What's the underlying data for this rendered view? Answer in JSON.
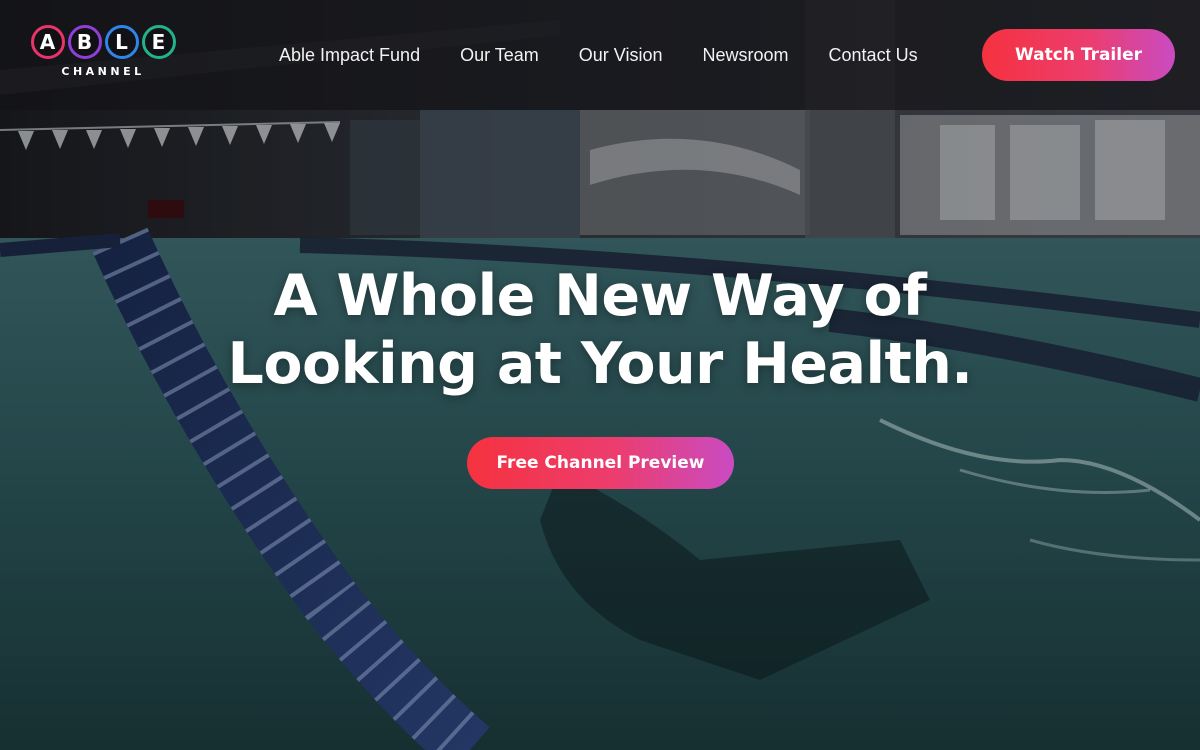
{
  "brand": {
    "logo_letters": [
      "A",
      "B",
      "L",
      "E"
    ],
    "logo_subtitle": "CHANNEL",
    "colors": {
      "ring_a": "#e8336b",
      "ring_b": "#8f3fd6",
      "ring_l": "#2f86e8",
      "ring_e": "#22b38a",
      "button_gradient_start": "#f5323f",
      "button_gradient_end": "#c94bc2"
    }
  },
  "nav": {
    "items": [
      {
        "label": "Able Impact Fund"
      },
      {
        "label": "Our Team"
      },
      {
        "label": "Our Vision"
      },
      {
        "label": "Newsroom"
      },
      {
        "label": "Contact Us"
      }
    ],
    "cta_label": "Watch Trailer"
  },
  "hero": {
    "headline_line1": "A Whole New Way of",
    "headline_line2": "Looking at Your Health.",
    "cta_label": "Free Channel Preview",
    "background": "indoor swimming pool with lane rope and swimmer"
  }
}
